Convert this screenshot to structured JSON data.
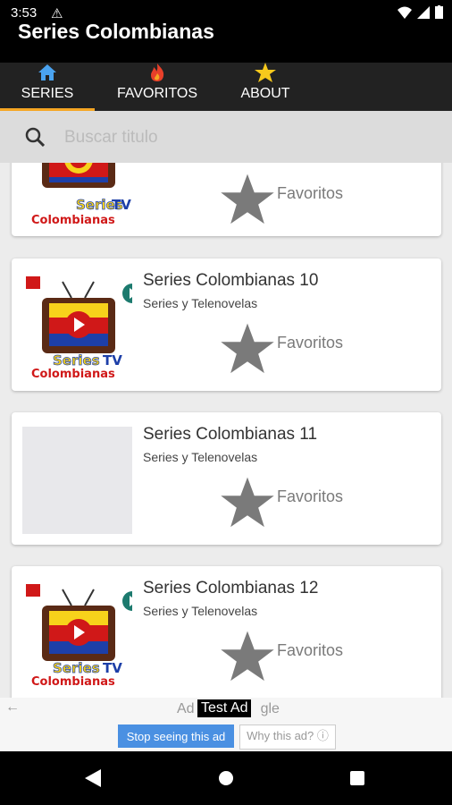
{
  "status_bar": {
    "time": "3:53"
  },
  "app": {
    "title": "Series Colombianas"
  },
  "tabs": [
    {
      "label": "SERIES",
      "icon": "home-icon"
    },
    {
      "label": "FAVORITOS",
      "icon": "fire-icon"
    },
    {
      "label": "ABOUT",
      "icon": "star-icon"
    }
  ],
  "search": {
    "placeholder": "Buscar titulo"
  },
  "thumb_text": {
    "line1": "Series",
    "tv": "TV",
    "line2": "Colombianas"
  },
  "cards": [
    {
      "title": "Series Colombianas 10",
      "subtitle": "Series y Telenovelas",
      "favorite_label": "Favoritos"
    },
    {
      "title": "Series Colombianas 11",
      "subtitle": "Series y Telenovelas",
      "favorite_label": "Favoritos"
    },
    {
      "title": "Series Colombianas 12",
      "subtitle": "Series y Telenovelas",
      "favorite_label": "Favoritos"
    }
  ],
  "partial_card": {
    "favorite_label": "Favoritos"
  },
  "ad": {
    "prefix": "Ad",
    "suffix": "gle",
    "test_label": "Test Ad",
    "stop_button": "Stop seeing this ad",
    "why_button": "Why this ad? ⓘ"
  },
  "colors": {
    "accent": "#f5a623",
    "star": "#7a7a7a",
    "play": "#1c7a6e",
    "ad_button": "#4a90e2"
  }
}
